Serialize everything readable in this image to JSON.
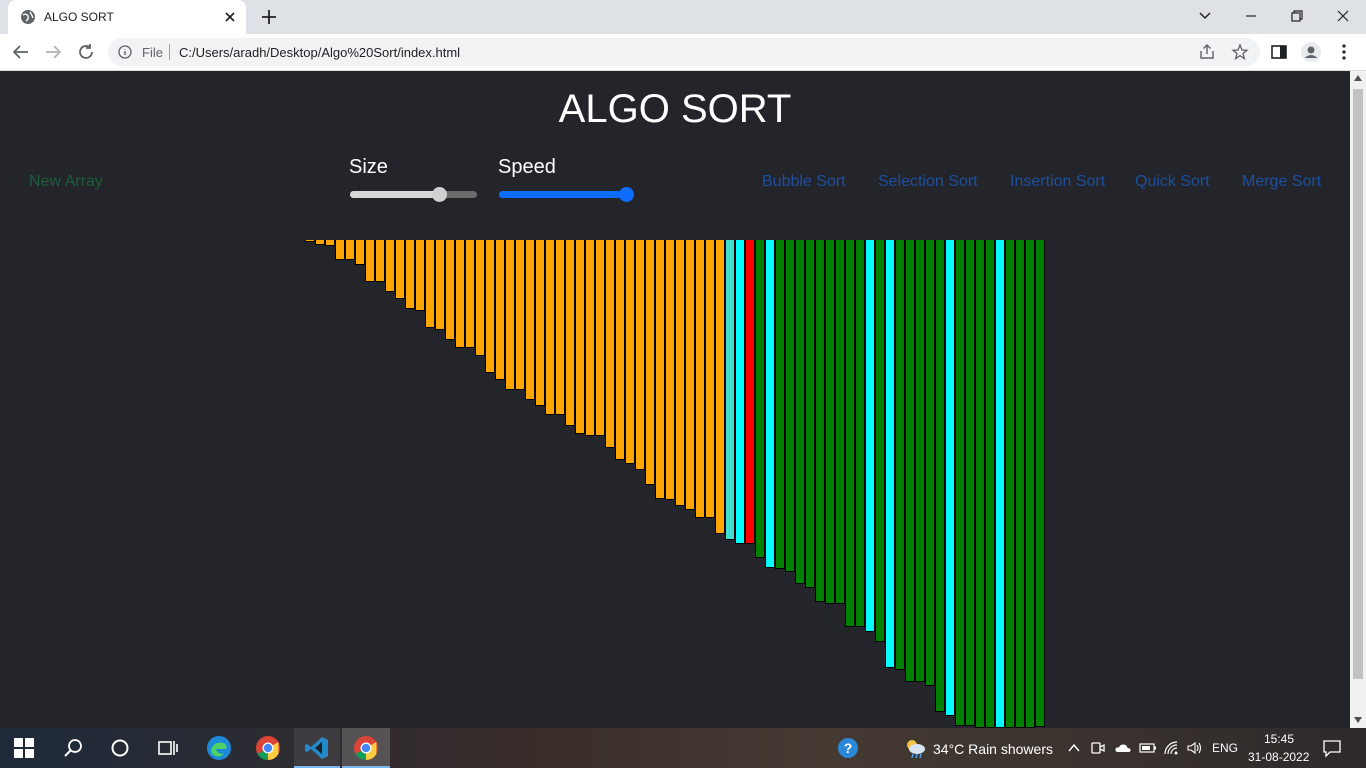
{
  "browser": {
    "tab_title": "ALGO SORT",
    "file_label": "File",
    "url": "C:/Users/aradh/Desktop/Algo%20Sort/index.html"
  },
  "page": {
    "title": "ALGO SORT",
    "new_array_label": "New Array",
    "size_label": "Size",
    "speed_label": "Speed",
    "size_value_fraction": 0.7,
    "speed_value_fraction": 1.0,
    "algorithms": [
      "Bubble Sort",
      "Selection Sort",
      "Insertion Sort",
      "Quick Sort",
      "Merge Sort"
    ]
  },
  "colors": {
    "background": "#23252b",
    "unsorted": "#ffa500",
    "comparing": "#00ffff",
    "current": "#ff0000",
    "sorted": "#008000",
    "pivot": "#40e0d0",
    "new_array_text": "#1d5e3b",
    "algo_text": "#1d4f9e",
    "speed_track": "#0d6efd"
  },
  "bars": {
    "heights": [
      2,
      5,
      6,
      20,
      20,
      25,
      42,
      42,
      52,
      59,
      69,
      71,
      88,
      90,
      100,
      108,
      108,
      116,
      133,
      140,
      150,
      150,
      160,
      166,
      175,
      175,
      186,
      194,
      196,
      196,
      208,
      220,
      224,
      230,
      245,
      259,
      260,
      266,
      270,
      278,
      278,
      294,
      300,
      304,
      304,
      318,
      328,
      329,
      332,
      344,
      348,
      362,
      364,
      364,
      387,
      387,
      392,
      402,
      428,
      430,
      442,
      442,
      446,
      472,
      476,
      486,
      486,
      501,
      501,
      516,
      516,
      526,
      532,
      487
    ],
    "colors": [
      "o",
      "o",
      "o",
      "o",
      "o",
      "o",
      "o",
      "o",
      "o",
      "o",
      "o",
      "o",
      "o",
      "o",
      "o",
      "o",
      "o",
      "o",
      "o",
      "o",
      "o",
      "o",
      "o",
      "o",
      "o",
      "o",
      "o",
      "o",
      "o",
      "o",
      "o",
      "o",
      "o",
      "o",
      "o",
      "o",
      "o",
      "o",
      "o",
      "o",
      "o",
      "o",
      "p",
      "c",
      "r",
      "g",
      "c",
      "g",
      "g",
      "g",
      "g",
      "g",
      "g",
      "g",
      "g",
      "g",
      "c",
      "g",
      "c",
      "g",
      "g",
      "g",
      "g",
      "g",
      "c",
      "g",
      "g",
      "g",
      "g",
      "c",
      "g",
      "g",
      "g",
      "g"
    ]
  },
  "taskbar": {
    "weather_text": "34°C  Rain showers",
    "language": "ENG",
    "time": "15:45",
    "date": "31-08-2022"
  }
}
